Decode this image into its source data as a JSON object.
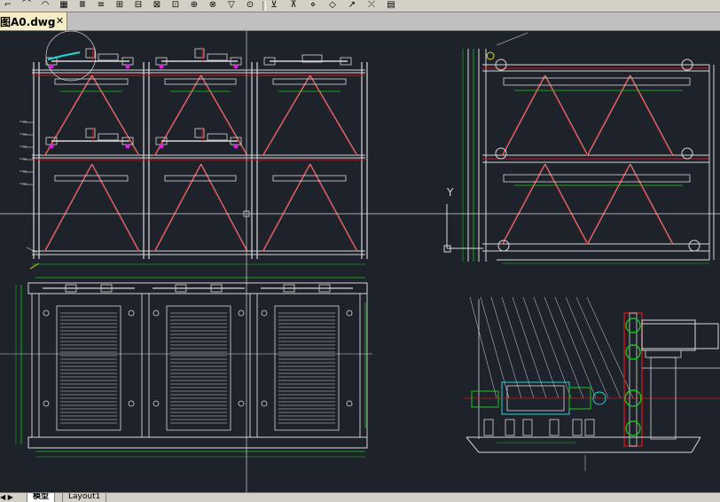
{
  "toolbar": {
    "icons": [
      {
        "name": "draw-line-icon",
        "glyph": "⌐"
      },
      {
        "name": "draw-polyline-icon",
        "glyph": "⌒"
      },
      {
        "name": "draw-arc-icon",
        "glyph": "◠"
      },
      {
        "name": "draw-table-icon",
        "glyph": "▦"
      },
      {
        "name": "dim-linear-icon",
        "glyph": "Ⅲ"
      },
      {
        "name": "dim-aligned-icon",
        "glyph": "≡"
      },
      {
        "name": "dim-baseline-icon",
        "glyph": "⊞"
      },
      {
        "name": "dim-continue-icon",
        "glyph": "⊟"
      },
      {
        "name": "dim-angular-icon",
        "glyph": "⊠"
      },
      {
        "name": "dim-ordinate-icon",
        "glyph": "⊡"
      },
      {
        "name": "dim-radius-icon",
        "glyph": "⊕"
      },
      {
        "name": "dim-diameter-icon",
        "glyph": "⊗"
      },
      {
        "name": "tolerance-icon",
        "glyph": "▽"
      },
      {
        "name": "center-mark-icon",
        "glyph": "⊙"
      },
      {
        "name": "dim-edit-icon",
        "glyph": "⊻"
      },
      {
        "name": "dim-text-edit-icon",
        "glyph": "⊼"
      },
      {
        "name": "dim-update-icon",
        "glyph": "⋄"
      },
      {
        "name": "dim-style-icon",
        "glyph": "◇"
      },
      {
        "name": "quick-leader-icon",
        "glyph": "↗"
      },
      {
        "name": "dim-override-icon",
        "glyph": "⤬"
      },
      {
        "name": "dim-dialog-icon",
        "glyph": "▤"
      }
    ]
  },
  "document": {
    "tab_label": "图A0.dwg",
    "close_glyph": "✕"
  },
  "ucs": {
    "y_label": "Y"
  },
  "layout_tabs": {
    "scroll_glyph": "◀ ▶",
    "model": "模型",
    "layout1": "Layout1"
  },
  "colors": {
    "background": "#1e222b",
    "frame": "#d8d8d8",
    "brace": "#c81818",
    "dimension": "#18c818",
    "magenta": "#e020e0",
    "cyan": "#20d8d8"
  }
}
